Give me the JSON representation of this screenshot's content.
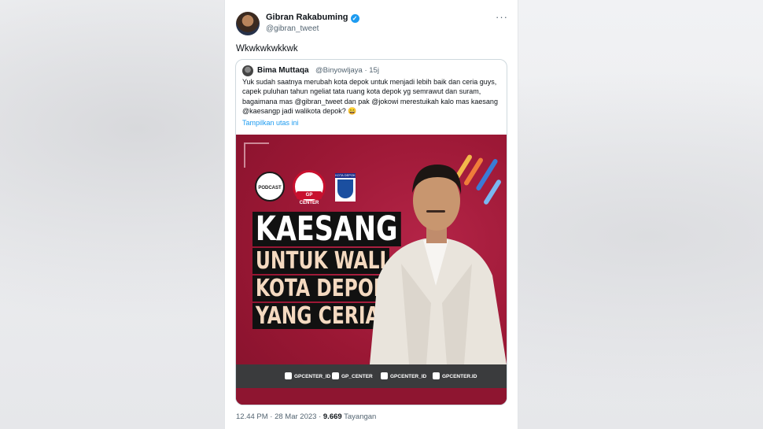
{
  "author": {
    "name": "Gibran Rakabuming",
    "handle": "@gibran_tweet",
    "verified": true,
    "more_icon": "more-horizontal-icon"
  },
  "tweet_text": "Wkwkwkwkkwk",
  "quoted": {
    "name": "Bima Muttaqa",
    "handle": "@Binyowljaya · 15j",
    "text": "Yuk sudah saatnya merubah kota depok untuk menjadi lebih baik dan ceria guys, capek puluhan tahun ngeliat tata ruang kota depok yg semrawut dan suram, bagaimana mas @gibran_tweet dan pak @jokowi merestuikah kalo mas kaesang @kaesangp jadi walikota depok? 😄",
    "show_thread": "Tampilkan utas ini"
  },
  "poster": {
    "headline_1": "KAESANG",
    "headline_2": "UNTUK WALI",
    "headline_3": "KOTA DEPOK",
    "headline_4": "YANG CERIA",
    "logo_gp": "GP CENTER",
    "logo_kota": "KOTA DEPOK",
    "socials": [
      "GPCENTER_ID",
      "GP_CENTER",
      "GPCENTER_ID",
      "GPCENTER.ID"
    ],
    "colors": {
      "background": "#a11b3a",
      "bar": "#3a3b3d"
    }
  },
  "meta": {
    "time": "12.44 PM · 28 Mar 2023 · ",
    "views": "9.669",
    "views_label": " Tayangan"
  }
}
